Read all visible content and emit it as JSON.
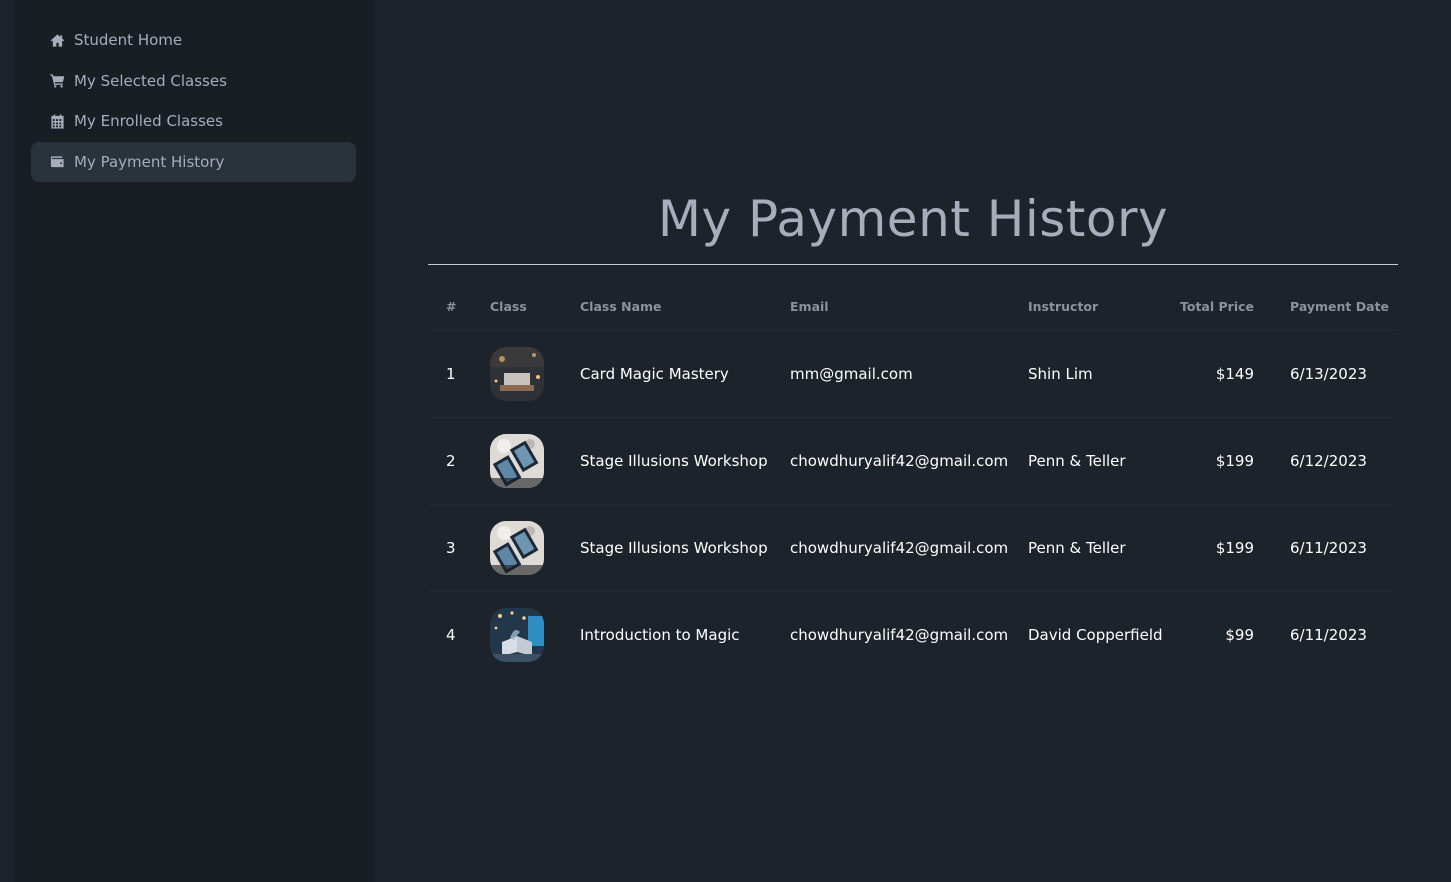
{
  "sidebar": {
    "items": [
      {
        "label": "Student Home",
        "icon": "home-icon",
        "active": false
      },
      {
        "label": "My Selected Classes",
        "icon": "cart-icon",
        "active": false
      },
      {
        "label": "My Enrolled Classes",
        "icon": "calendar-icon",
        "active": false
      },
      {
        "label": "My Payment History",
        "icon": "wallet-icon",
        "active": true
      }
    ]
  },
  "main": {
    "title": "My Payment History",
    "table": {
      "headers": [
        "#",
        "Class",
        "Class Name",
        "Email",
        "Instructor",
        "Total Price",
        "Payment Date"
      ],
      "rows": [
        {
          "num": "1",
          "thumb": "card-magic-image",
          "class_name": "Card Magic Mastery",
          "email": "mm@gmail.com",
          "instructor": "Shin Lim",
          "price": "$149",
          "date": "6/13/2023"
        },
        {
          "num": "2",
          "thumb": "tarot-cards-image",
          "class_name": "Stage Illusions Workshop",
          "email": "chowdhuryalif42@gmail.com",
          "instructor": "Penn & Teller",
          "price": "$199",
          "date": "6/12/2023"
        },
        {
          "num": "3",
          "thumb": "tarot-cards-image",
          "class_name": "Stage Illusions Workshop",
          "email": "chowdhuryalif42@gmail.com",
          "instructor": "Penn & Teller",
          "price": "$199",
          "date": "6/11/2023"
        },
        {
          "num": "4",
          "thumb": "magic-book-image",
          "class_name": "Introduction to Magic",
          "email": "chowdhuryalif42@gmail.com",
          "instructor": "David Copperfield",
          "price": "$99",
          "date": "6/11/2023"
        }
      ]
    }
  },
  "colors": {
    "background": "#1d232a",
    "sidebar": "#191e24",
    "active_item": "#2a323c",
    "text_muted": "#a6adbb",
    "text_cell": "#ffffff"
  }
}
